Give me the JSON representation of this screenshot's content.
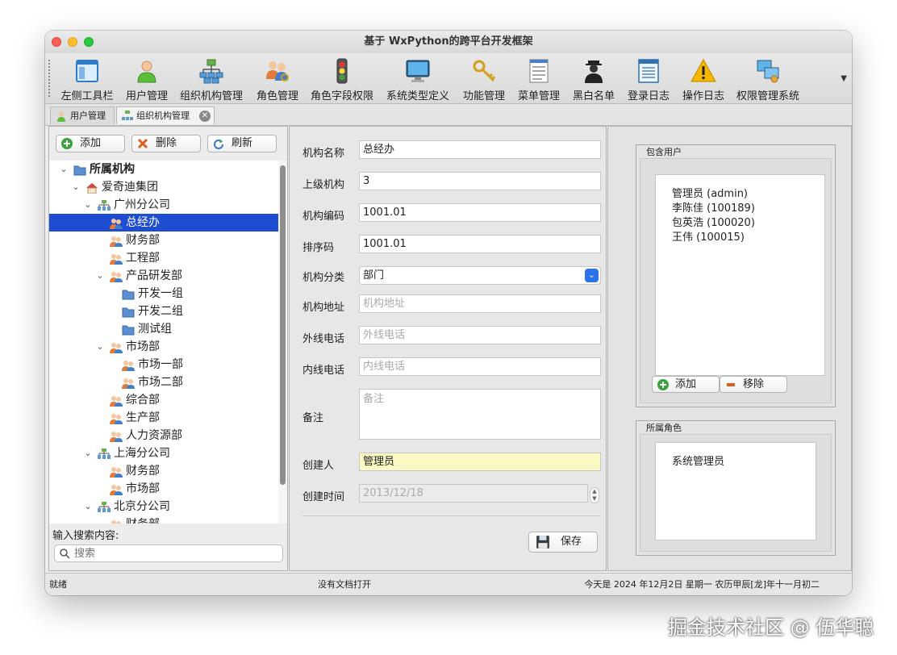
{
  "window": {
    "title": "基于 WxPython的跨平台开发框架"
  },
  "toolbar": {
    "items": [
      {
        "label": "左侧工具栏",
        "icon": "window-panel-icon"
      },
      {
        "label": "用户管理",
        "icon": "user-icon"
      },
      {
        "label": "组织机构管理",
        "icon": "org-chart-icon"
      },
      {
        "label": "角色管理",
        "icon": "users-key-icon"
      },
      {
        "label": "角色字段权限",
        "icon": "traffic-light-icon"
      },
      {
        "label": "系统类型定义",
        "icon": "monitor-icon"
      },
      {
        "label": "功能管理",
        "icon": "keys-icon"
      },
      {
        "label": "菜单管理",
        "icon": "menu-icon"
      },
      {
        "label": "黑白名单",
        "icon": "agent-icon"
      },
      {
        "label": "登录日志",
        "icon": "log-icon"
      },
      {
        "label": "操作日志",
        "icon": "warning-icon"
      },
      {
        "label": "权限管理系统",
        "icon": "network-icon"
      }
    ]
  },
  "tabs": [
    {
      "label": "用户管理"
    },
    {
      "label": "组织机构管理"
    }
  ],
  "left": {
    "add_label": "添加",
    "delete_label": "删除",
    "refresh_label": "刷新",
    "tree": [
      {
        "label": "所属机构",
        "level": 0,
        "icon": "folder",
        "arrow": "open",
        "bold": true
      },
      {
        "label": "爱奇迪集团",
        "level": 1,
        "icon": "home",
        "arrow": "open"
      },
      {
        "label": "广州分公司",
        "level": 2,
        "icon": "org",
        "arrow": "open"
      },
      {
        "label": "总经办",
        "level": 3,
        "icon": "people",
        "arrow": "",
        "selected": true
      },
      {
        "label": "财务部",
        "level": 3,
        "icon": "people",
        "arrow": ""
      },
      {
        "label": "工程部",
        "level": 3,
        "icon": "people",
        "arrow": ""
      },
      {
        "label": "产品研发部",
        "level": 3,
        "icon": "people",
        "arrow": "open"
      },
      {
        "label": "开发一组",
        "level": 4,
        "icon": "folder",
        "arrow": ""
      },
      {
        "label": "开发二组",
        "level": 4,
        "icon": "folder",
        "arrow": ""
      },
      {
        "label": "测试组",
        "level": 4,
        "icon": "folder",
        "arrow": ""
      },
      {
        "label": "市场部",
        "level": 3,
        "icon": "people",
        "arrow": "open"
      },
      {
        "label": "市场一部",
        "level": 4,
        "icon": "people",
        "arrow": ""
      },
      {
        "label": "市场二部",
        "level": 4,
        "icon": "people",
        "arrow": ""
      },
      {
        "label": "综合部",
        "level": 3,
        "icon": "people",
        "arrow": ""
      },
      {
        "label": "生产部",
        "level": 3,
        "icon": "people",
        "arrow": ""
      },
      {
        "label": "人力资源部",
        "level": 3,
        "icon": "people",
        "arrow": ""
      },
      {
        "label": "上海分公司",
        "level": 2,
        "icon": "org",
        "arrow": "open"
      },
      {
        "label": "财务部",
        "level": 3,
        "icon": "people",
        "arrow": ""
      },
      {
        "label": "市场部",
        "level": 3,
        "icon": "people",
        "arrow": ""
      },
      {
        "label": "北京分公司",
        "level": 2,
        "icon": "org",
        "arrow": "open"
      },
      {
        "label": "财务部",
        "level": 3,
        "icon": "people",
        "arrow": ""
      }
    ],
    "search_label": "输入搜索内容:",
    "search_placeholder": "搜索"
  },
  "form": {
    "name_label": "机构名称",
    "name_value": "总经办",
    "parent_label": "上级机构",
    "parent_value": "3",
    "code_label": "机构编码",
    "code_value": "1001.01",
    "sort_label": "排序码",
    "sort_value": "1001.01",
    "category_label": "机构分类",
    "category_value": "部门",
    "address_label": "机构地址",
    "address_placeholder": "机构地址",
    "outer_phone_label": "外线电话",
    "outer_phone_placeholder": "外线电话",
    "inner_phone_label": "内线电话",
    "inner_phone_placeholder": "内线电话",
    "note_label": "备注",
    "note_placeholder": "备注",
    "creator_label": "创建人",
    "creator_value": "管理员",
    "created_label": "创建时间",
    "created_value": "2013/12/18",
    "save_label": "保存"
  },
  "right": {
    "users_title": "包含用户",
    "users": [
      "管理员 (admin)",
      "李陈佳 (100189)",
      "包英浩 (100020)",
      "王伟 (100015)"
    ],
    "add_label": "添加",
    "remove_label": "移除",
    "roles_title": "所属角色",
    "roles": [
      "系统管理员"
    ]
  },
  "status": {
    "left": "就绪",
    "center": "没有文档打开",
    "right": "今天是 2024 年12月2日 星期一 农历甲辰[龙]年十一月初二"
  },
  "watermark": "掘金技术社区 @ 伍华聪",
  "colors": {
    "selection": "#1f4dd2",
    "select_accent": "#2a73ea",
    "creator_field": "#fbf8c4"
  }
}
